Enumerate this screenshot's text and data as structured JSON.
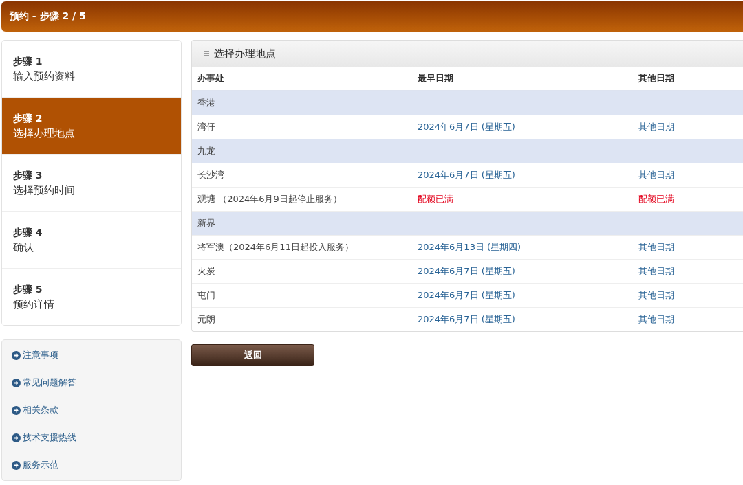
{
  "header": {
    "title": "预约 - 步骤 2 / 5"
  },
  "steps": [
    {
      "label": "步骤 1",
      "title": "输入预约资料",
      "selected": false
    },
    {
      "label": "步骤 2",
      "title": "选择办理地点",
      "selected": true
    },
    {
      "label": "步骤 3",
      "title": "选择预约时间",
      "selected": false
    },
    {
      "label": "步骤 4",
      "title": "确认",
      "selected": false
    },
    {
      "label": "步骤 5",
      "title": "预约详情",
      "selected": false
    }
  ],
  "links": [
    "注意事项",
    "常见问题解答",
    "相关条款",
    "技术支援热线",
    "服务示范"
  ],
  "panel": {
    "title": "选择办理地点"
  },
  "table": {
    "columns": [
      "办事处",
      "最早日期",
      "其他日期"
    ],
    "rows": [
      {
        "kind": "group",
        "name": "香港"
      },
      {
        "kind": "office",
        "name": "湾仔",
        "earliest": "2024年6月7日 (星期五)",
        "other": "其他日期",
        "quota_full": false
      },
      {
        "kind": "group",
        "name": "九龙"
      },
      {
        "kind": "office",
        "name": "长沙湾",
        "earliest": "2024年6月7日 (星期五)",
        "other": "其他日期",
        "quota_full": false
      },
      {
        "kind": "office",
        "name": "观塘 （2024年6月9日起停止服务）",
        "earliest": "配额已满",
        "other": "配额已满",
        "quota_full": true
      },
      {
        "kind": "group",
        "name": "新界"
      },
      {
        "kind": "office",
        "name": "将军澳（2024年6月11日起投入服务）",
        "earliest": "2024年6月13日 (星期四)",
        "other": "其他日期",
        "quota_full": false
      },
      {
        "kind": "office",
        "name": "火炭",
        "earliest": "2024年6月7日 (星期五)",
        "other": "其他日期",
        "quota_full": false
      },
      {
        "kind": "office",
        "name": "屯门",
        "earliest": "2024年6月7日 (星期五)",
        "other": "其他日期",
        "quota_full": false
      },
      {
        "kind": "office",
        "name": "元朗",
        "earliest": "2024年6月7日 (星期五)",
        "other": "其他日期",
        "quota_full": false
      }
    ]
  },
  "back_button": "返回"
}
